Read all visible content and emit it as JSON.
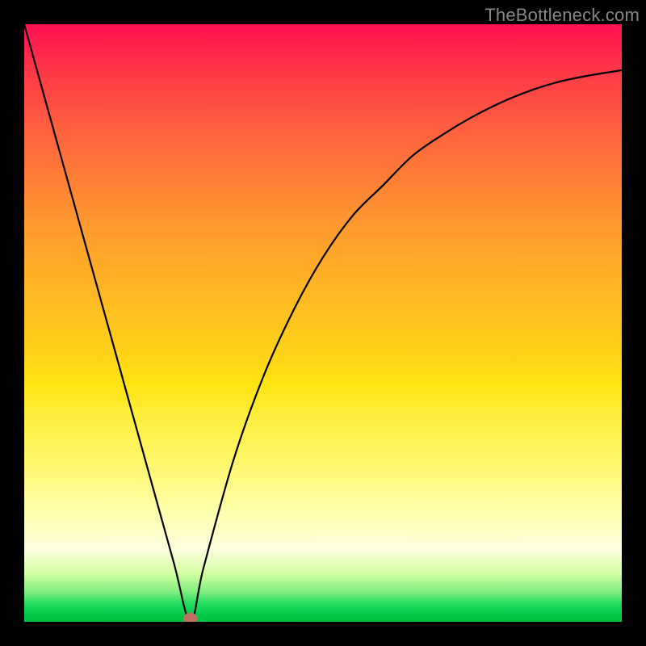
{
  "watermark": "TheBottleneck.com",
  "chart_data": {
    "type": "line",
    "title": "",
    "xlabel": "",
    "ylabel": "",
    "xlim": [
      0,
      100
    ],
    "ylim": [
      0,
      100
    ],
    "series": [
      {
        "name": "bottleneck-curve",
        "x": [
          0,
          5,
          10,
          15,
          20,
          25,
          27.8,
          30,
          35,
          40,
          45,
          50,
          55,
          60,
          65,
          70,
          75,
          80,
          85,
          90,
          95,
          100
        ],
        "y": [
          100,
          82,
          64,
          46,
          28,
          10,
          0,
          9,
          27,
          41,
          52,
          61,
          68,
          73,
          78,
          81.5,
          84.5,
          87,
          89,
          90.5,
          91.5,
          92.3
        ]
      }
    ],
    "marker": {
      "x": 27.8,
      "y": 0
    },
    "background_gradient": {
      "top": "#ff1050",
      "bottom": "#00c040",
      "stops": [
        "#ff1050",
        "#ff7838",
        "#ffc020",
        "#fff870",
        "#80ee80",
        "#00c040"
      ]
    }
  }
}
